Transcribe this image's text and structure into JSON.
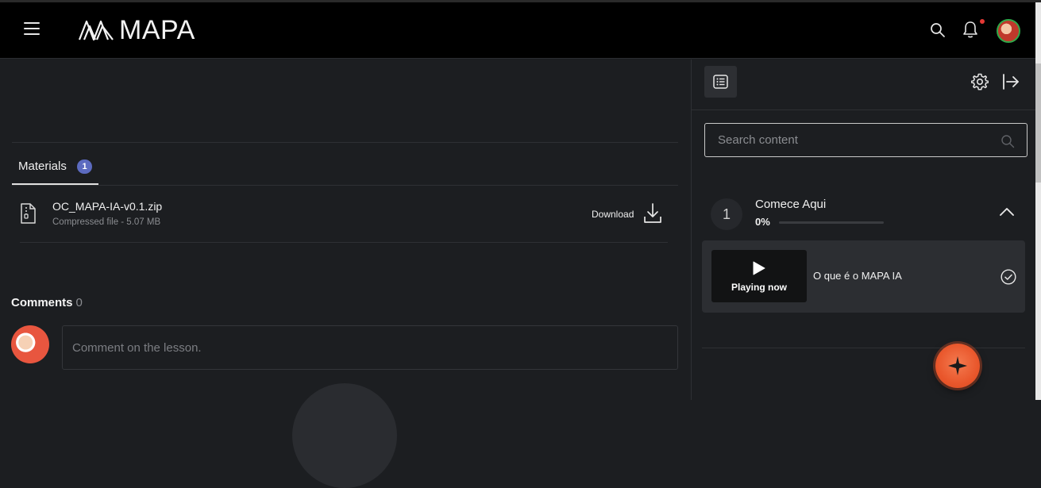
{
  "header": {
    "logo_text": "MAPA",
    "notification_dot": true
  },
  "materials": {
    "tab_label": "Materials",
    "badge_count": "1",
    "files": [
      {
        "name": "OC_MAPA-IA-v0.1.zip",
        "meta": "Compressed file - 5.07 MB",
        "action_label": "Download"
      }
    ]
  },
  "comments": {
    "title": "Comments",
    "count": "0",
    "placeholder": "Comment on the lesson."
  },
  "sidebar": {
    "search_placeholder": "Search content",
    "modules": [
      {
        "number": "1",
        "title": "Comece Aqui",
        "progress_label": "0%",
        "progress": 0,
        "lessons": [
          {
            "status_label": "Playing now",
            "title": "O que é o MAPA IA",
            "completed": true
          }
        ]
      }
    ]
  },
  "colors": {
    "accent": "#5c6bc0",
    "fab": "#e9572c",
    "notification": "#e53935",
    "background": "#1c1e21",
    "header": "#000000"
  },
  "icons": [
    "hamburger-icon",
    "search-icon",
    "bell-icon",
    "file-zip-icon",
    "download-icon",
    "list-icon",
    "gear-icon",
    "exit-icon",
    "play-icon",
    "check-circle-icon",
    "chevron-up-icon",
    "sparkle-icon"
  ]
}
